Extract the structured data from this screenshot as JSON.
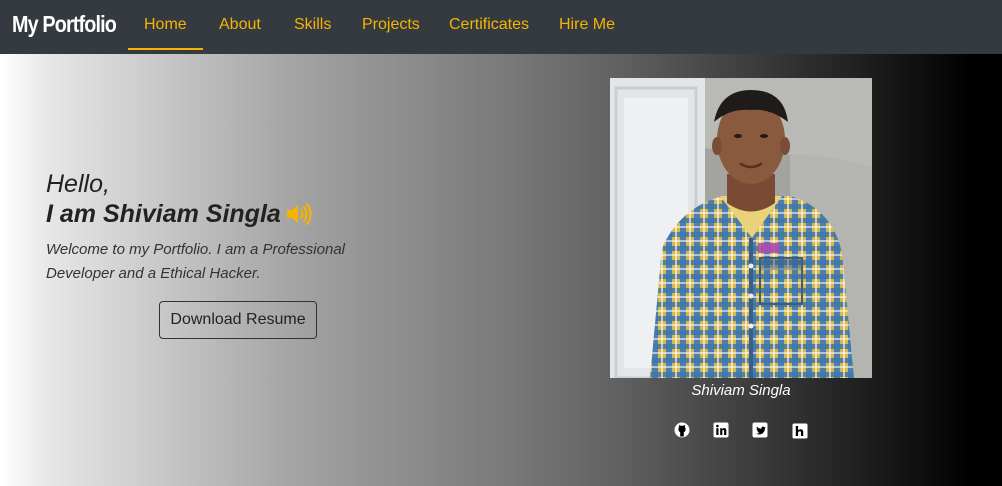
{
  "navbar": {
    "brand": "My Portfolio",
    "items": [
      {
        "label": "Home",
        "active": true
      },
      {
        "label": "About"
      },
      {
        "label": "Skills"
      },
      {
        "label": "Projects"
      },
      {
        "label": "Certificates"
      },
      {
        "label": "Hire Me"
      }
    ]
  },
  "hero": {
    "greeting": "Hello,",
    "name_line": "I am Shiviam Singla",
    "intro": "Welcome to my Portfolio. I am a Professional Developer and a Ethical Hacker.",
    "resume_button": "Download Resume",
    "speaker_icon": "speaker-icon"
  },
  "profile": {
    "photo": "profile-photo",
    "caption": "Shiviam Singla",
    "social_icons": [
      "github-icon",
      "linkedin-icon",
      "twitter-icon",
      "hackerrank-icon"
    ]
  },
  "colors": {
    "navbar_bg": "#343a40",
    "accent": "#f4b400",
    "text_dark": "#222222",
    "text_light": "#ffffff"
  }
}
